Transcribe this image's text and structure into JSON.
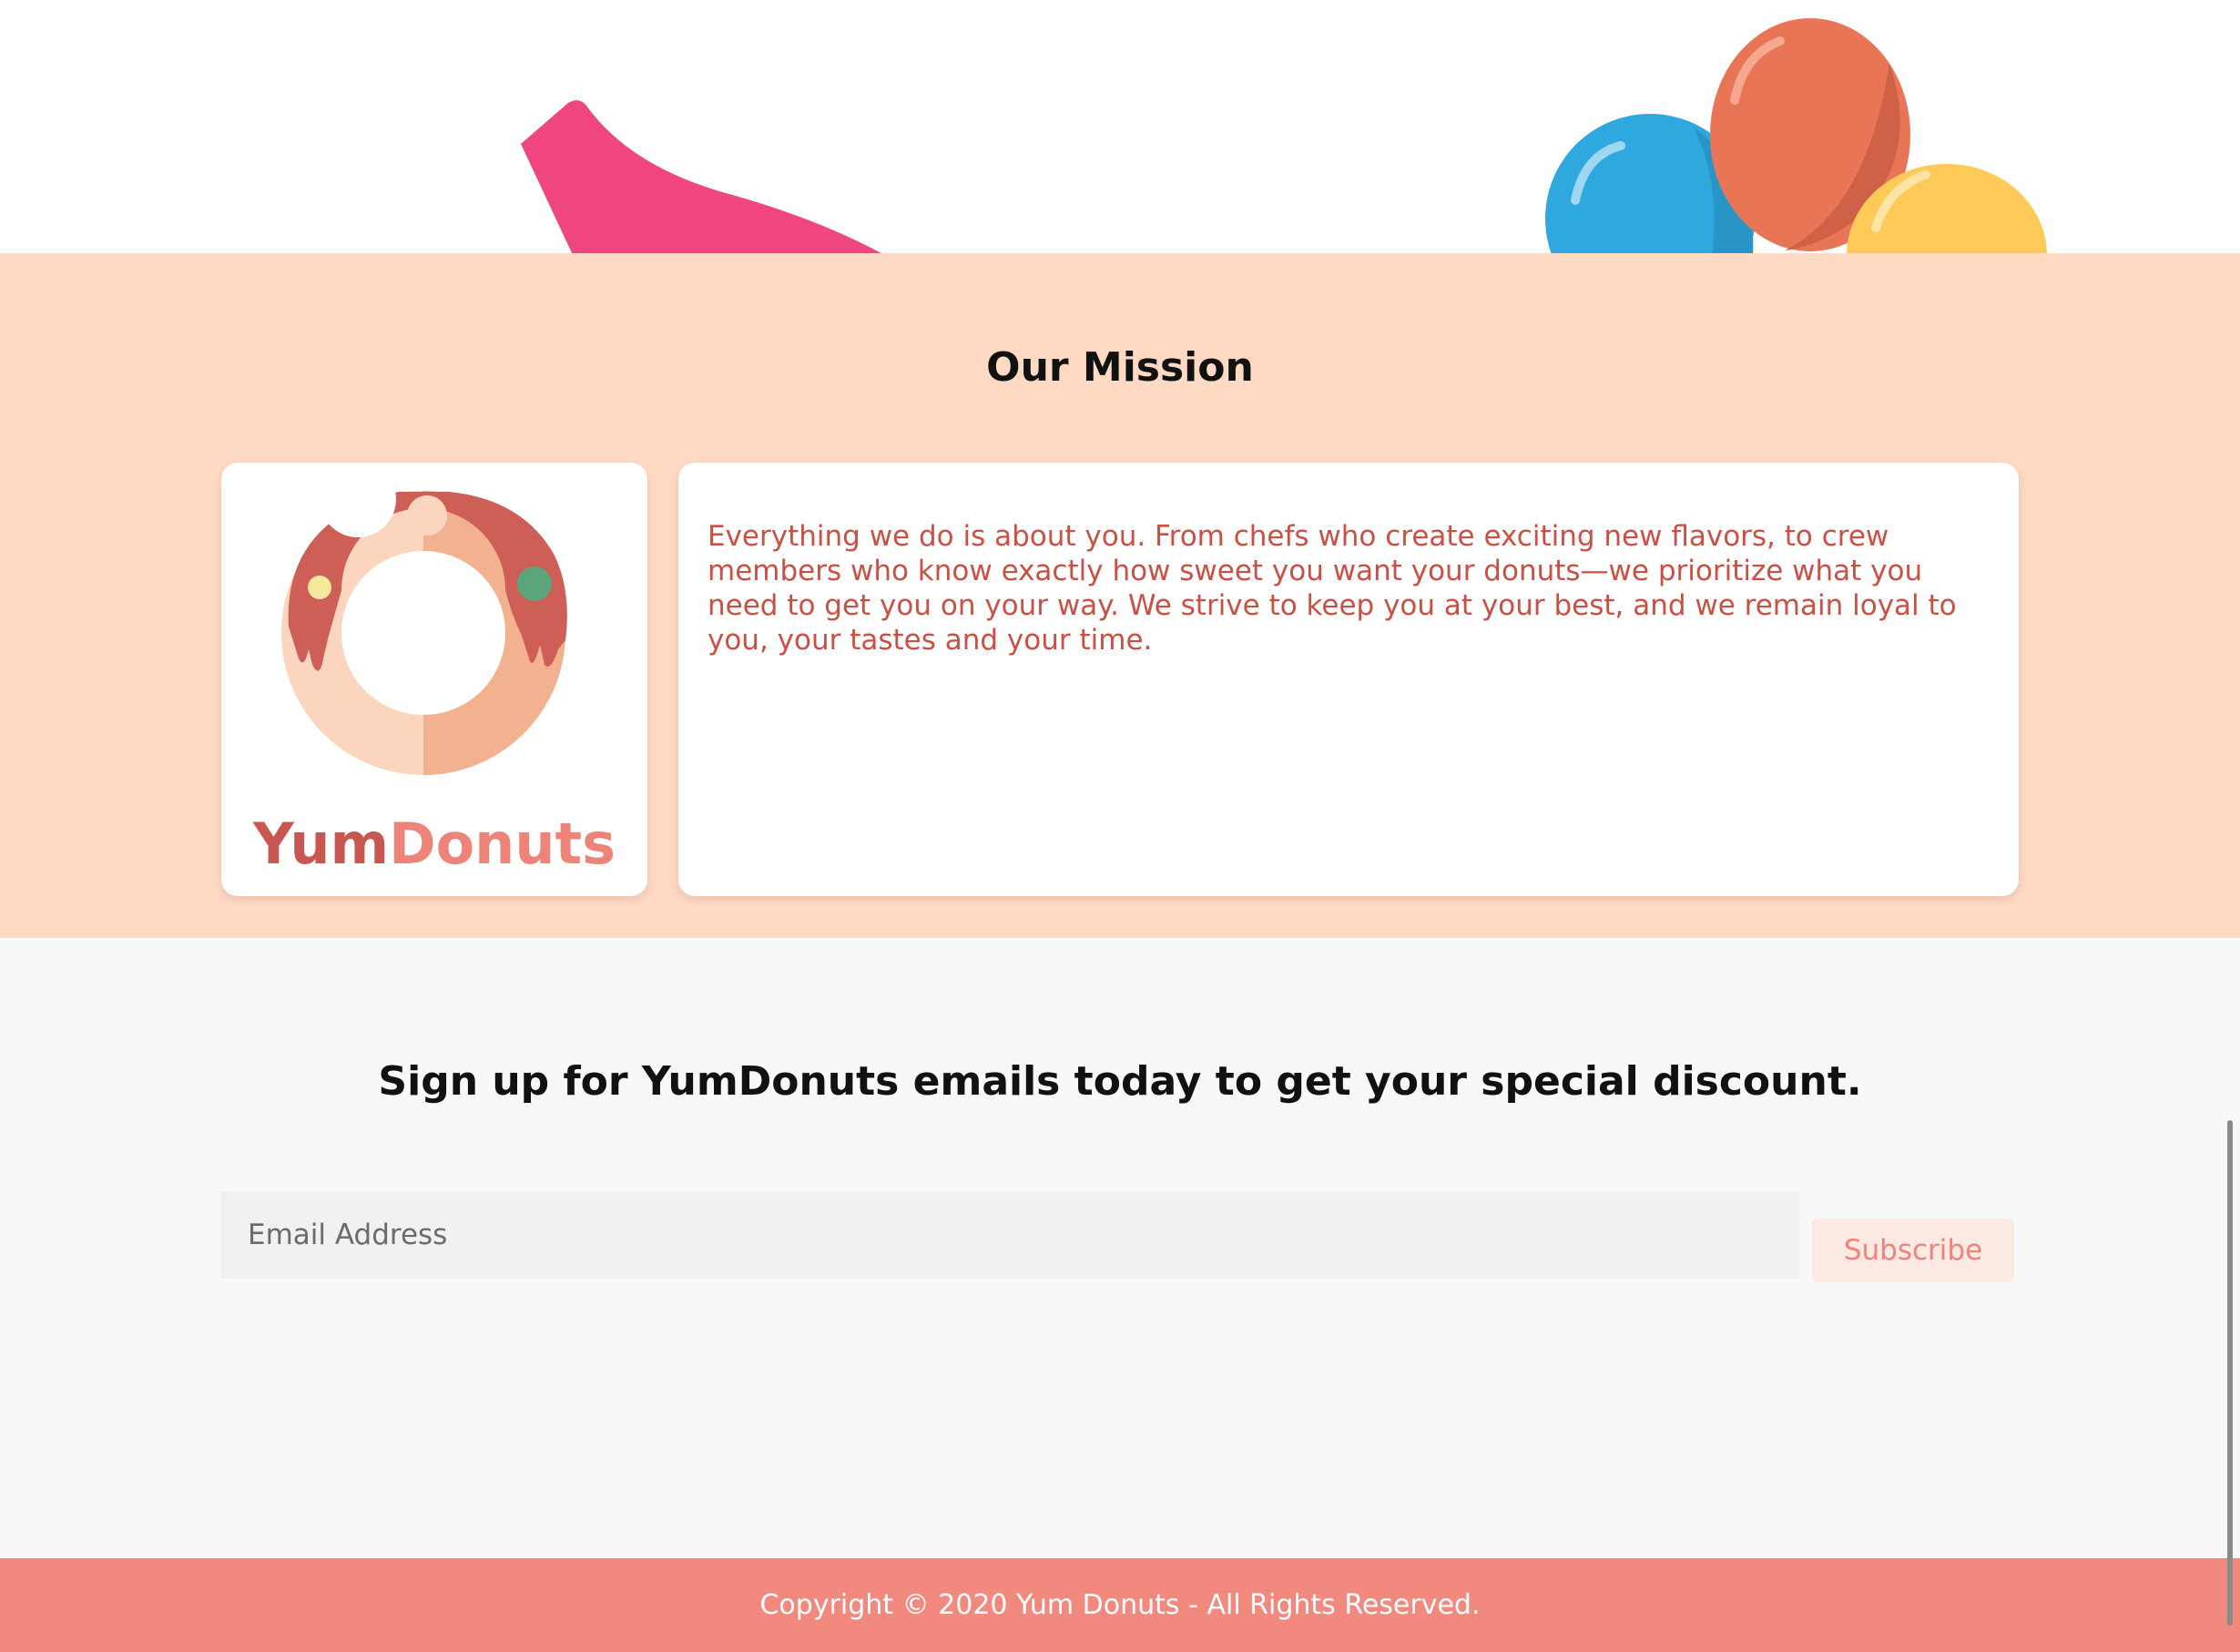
{
  "mission": {
    "title": "Our Mission",
    "text": "Everything we do is about you. From chefs who create exciting new flavors, to crew members who know exactly how sweet you want your donuts—we prioritize what you need to get you on your way. We strive to keep you at your best, and we remain loyal to you, your tastes and your time.",
    "logo": {
      "wordmark_dark": "Yum",
      "wordmark_light": "Donuts",
      "icon": "donut-icon"
    }
  },
  "signup": {
    "title": "Sign up for YumDonuts emails today to get your special discount.",
    "email_placeholder": "Email Address",
    "subscribe_label": "Subscribe"
  },
  "footer": {
    "copyright": "Copyright © 2020 Yum Donuts - All Rights Reserved."
  },
  "colors": {
    "mission_bg": "#fedac4",
    "signup_bg": "#f8f8f8",
    "footer_bg": "#f1897f",
    "mission_text": "#cc4f43",
    "accent": "#ee8479"
  }
}
